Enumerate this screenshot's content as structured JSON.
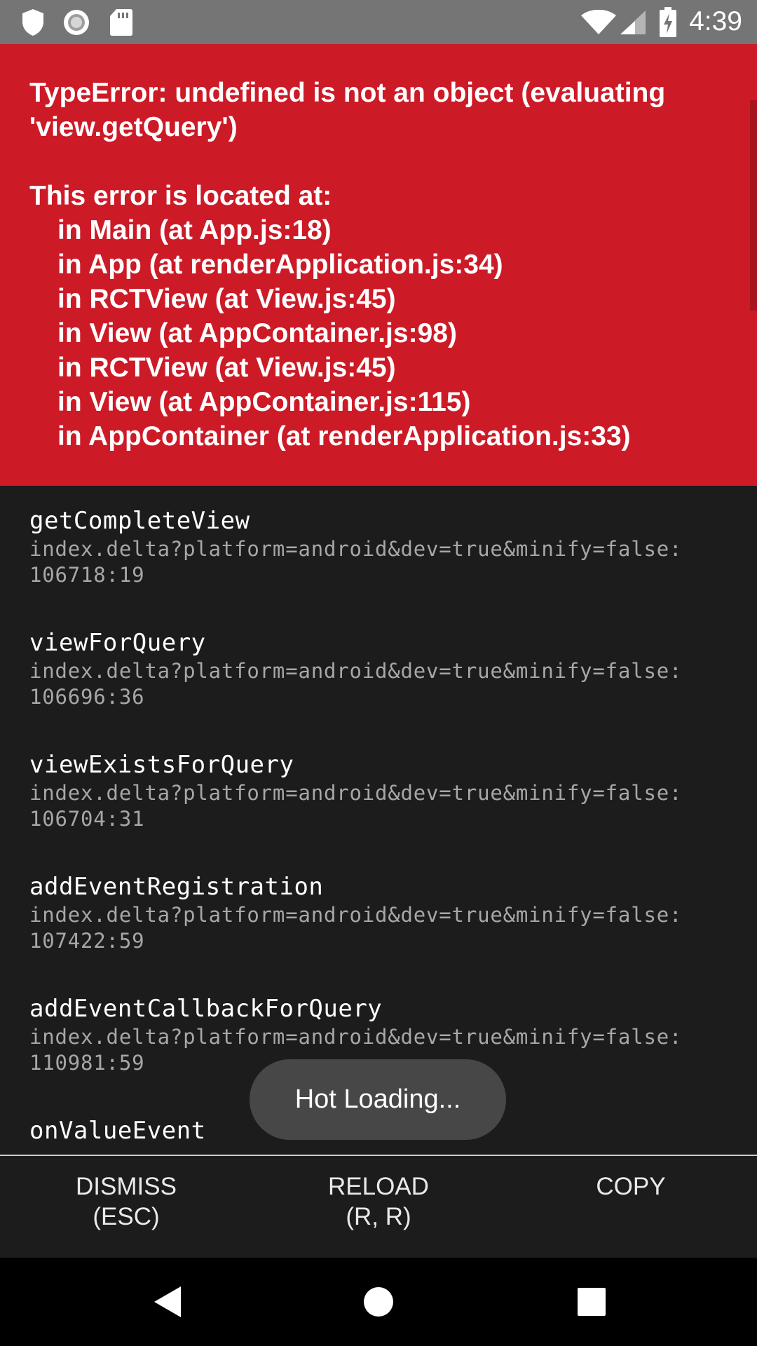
{
  "status_bar": {
    "time": "4:39",
    "left_icons": [
      "shield-icon",
      "circle-record-icon",
      "sd-card-icon"
    ],
    "right_icons": [
      "wifi-icon",
      "cell-signal-icon",
      "battery-charging-icon"
    ]
  },
  "error": {
    "message": "TypeError: undefined is not an object (evaluating\n'view.getQuery')",
    "location_title": "This error is located at:",
    "component_stack": [
      "in Main (at App.js:18)",
      "in App (at renderApplication.js:34)",
      "in RCTView (at View.js:45)",
      "in View (at AppContainer.js:98)",
      "in RCTView (at View.js:45)",
      "in View (at AppContainer.js:115)",
      "in AppContainer (at renderApplication.js:33)"
    ],
    "background_color": "#cd1a27"
  },
  "stack_trace": [
    {
      "method": "getCompleteView",
      "file": "index.delta?platform=android&dev=true&minify=false:\n106718:19"
    },
    {
      "method": "viewForQuery",
      "file": "index.delta?platform=android&dev=true&minify=false:\n106696:36"
    },
    {
      "method": "viewExistsForQuery",
      "file": "index.delta?platform=android&dev=true&minify=false:\n106704:31"
    },
    {
      "method": "addEventRegistration",
      "file": "index.delta?platform=android&dev=true&minify=false:\n107422:59"
    },
    {
      "method": "addEventCallbackForQuery",
      "file": "index.delta?platform=android&dev=true&minify=false:\n110981:59"
    },
    {
      "method": "onValueEvent",
      "file": ""
    }
  ],
  "toast": {
    "text": "Hot Loading..."
  },
  "actions": {
    "dismiss": {
      "line1": "DISMISS",
      "line2": "(ESC)"
    },
    "reload": {
      "line1": "RELOAD",
      "line2": "(R, R)"
    },
    "copy": {
      "line1": "COPY",
      "line2": ""
    }
  },
  "nav_bar": {
    "icons": [
      "back-icon",
      "home-icon",
      "recents-icon"
    ]
  }
}
